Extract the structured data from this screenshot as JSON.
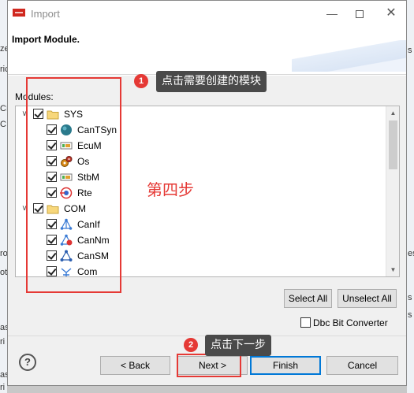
{
  "window": {
    "title": "Import"
  },
  "header": {
    "title": "Import Module."
  },
  "modules": {
    "label": "Modules:",
    "groups": [
      {
        "name": "SYS",
        "items": [
          "CanTSyn",
          "EcuM",
          "Os",
          "StbM",
          "Rte"
        ]
      },
      {
        "name": "COM",
        "items": [
          "CanIf",
          "CanNm",
          "CanSM",
          "Com"
        ]
      }
    ]
  },
  "buttons": {
    "select_all": "Select All",
    "unselect_all": "Unselect All",
    "back": "< Back",
    "next": "Next >",
    "finish": "Finish",
    "cancel": "Cancel",
    "help": "?"
  },
  "options": {
    "dbc_bit_converter": "Dbc Bit Converter"
  },
  "annotations": {
    "callout1_num": "1",
    "callout1_text": "点击需要创建的模块",
    "step_text": "第四步",
    "callout2_num": "2",
    "callout2_text": "点击下一步"
  },
  "background": {
    "left_frags": [
      "ze",
      "ric)",
      "CE",
      "C",
      "ro",
      "ot",
      "as",
      "ri",
      "as",
      "ri"
    ],
    "right_frags": [
      "s",
      "es",
      "s",
      "s"
    ]
  },
  "colors": {
    "annotation_red": "#e53935",
    "callout_bg": "#4a4a4a",
    "accent_blue": "#0078d7"
  }
}
